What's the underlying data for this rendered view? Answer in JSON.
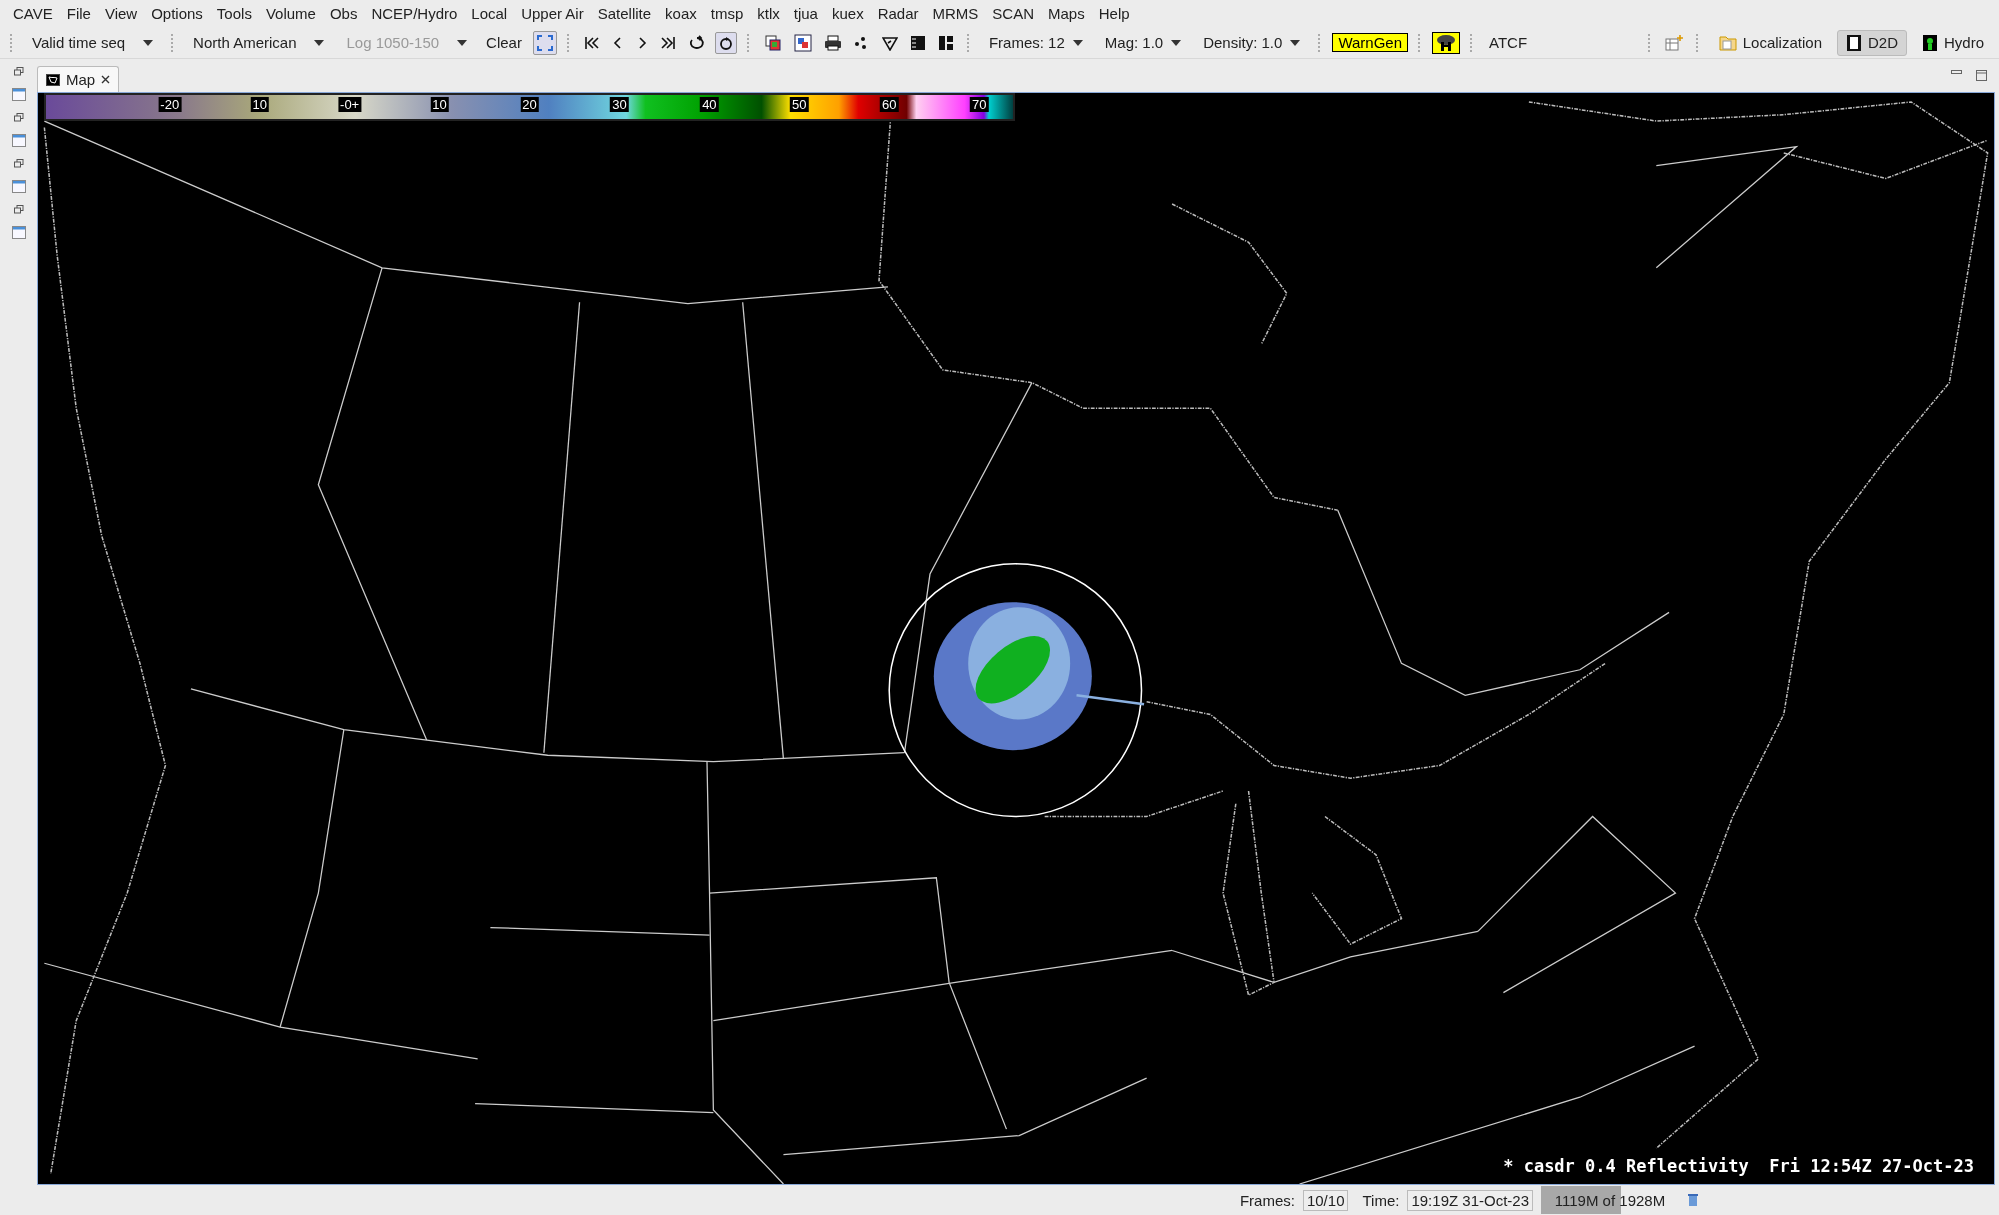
{
  "menu_bar": [
    "CAVE",
    "File",
    "View",
    "Options",
    "Tools",
    "Volume",
    "Obs",
    "NCEP/Hydro",
    "Local",
    "Upper Air",
    "Satellite",
    "koax",
    "tmsp",
    "ktlx",
    "tjua",
    "kuex",
    "Radar",
    "MRMS",
    "SCAN",
    "Maps",
    "Help"
  ],
  "toolbar": {
    "time_match": {
      "label": "Valid time seq",
      "disabled": false
    },
    "scale": {
      "label": "North American",
      "disabled": false
    },
    "product": {
      "label": "Log 1050-150",
      "disabled": true
    },
    "clear": "Clear",
    "frames": "Frames: 12",
    "mag": "Mag: 1.0",
    "density": "Density: 1.0",
    "warngen": "WarnGen",
    "atcf": "ATCF",
    "perspectives": [
      {
        "label": "Localization",
        "selected": false
      },
      {
        "label": "D2D",
        "selected": true
      },
      {
        "label": "Hydro",
        "selected": false
      }
    ]
  },
  "tabs": [
    {
      "label": "Map",
      "selected": true
    }
  ],
  "colorbar": {
    "labels": [
      "-20",
      "10",
      "-0+",
      "10",
      "20",
      "30",
      "40",
      "50",
      "60",
      "70"
    ]
  },
  "map": {
    "caption": "* casdr 0.4 Reflectivity  Fri 12:54Z 27-Oct-23"
  },
  "status_bar": {
    "frames_label": "Frames:",
    "frames_value": "10/10",
    "time_label": "Time:",
    "time_value": "19:19Z 31-Oct-23",
    "memory": "1119M of 1928M",
    "level": 0.58
  }
}
